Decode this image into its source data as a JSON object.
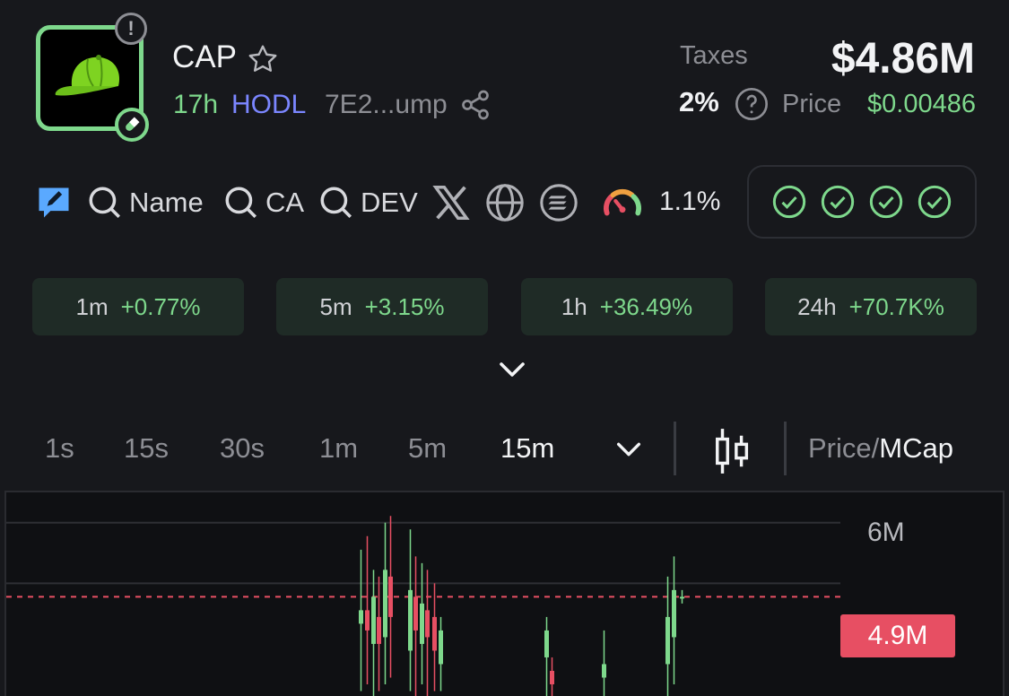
{
  "token": {
    "name": "CAP",
    "age": "17h",
    "tag": "HODL",
    "address": "7E2...ump",
    "warning_glyph": "!"
  },
  "stats": {
    "taxes_label": "Taxes",
    "taxes_value": "2%",
    "market_cap": "$4.86M",
    "price_label": "Price",
    "price_value": "$0.00486"
  },
  "tools": {
    "search_name": "Name",
    "search_ca": "CA",
    "search_dev": "DEV",
    "gauge_value": "1.1%",
    "icons": [
      "edit-icon",
      "search-icon",
      "x-icon",
      "globe-icon",
      "solana-icon",
      "gauge-icon"
    ],
    "checks_count": 4
  },
  "changes": [
    {
      "label": "1m",
      "value": "+0.77%"
    },
    {
      "label": "5m",
      "value": "+3.15%"
    },
    {
      "label": "1h",
      "value": "+36.49%"
    },
    {
      "label": "24h",
      "value": "+70.7K%"
    }
  ],
  "timeframes": {
    "items": [
      "1s",
      "15s",
      "30s",
      "1m",
      "5m",
      "15m"
    ],
    "active": "15m",
    "toggle_price": "Price",
    "toggle_sep": "/",
    "toggle_mcap": "MCap"
  },
  "chart_data": {
    "type": "candlestick",
    "y_ticks": [
      "6M"
    ],
    "current_value_label": "4.9M",
    "current_value": 4.9,
    "ylim": [
      3.4,
      6.45
    ],
    "colors": {
      "up": "#7ed88c",
      "down": "#e74f63",
      "grid": "#2e2f34",
      "current": "#e74f63"
    },
    "candles": [
      {
        "i": 0,
        "o": 4.5,
        "c": 4.7,
        "h": 5.6,
        "l": 3.5
      },
      {
        "i": 1,
        "o": 4.7,
        "c": 4.4,
        "h": 5.8,
        "l": 3.6
      },
      {
        "i": 2,
        "o": 4.2,
        "c": 4.9,
        "h": 5.3,
        "l": 3.4
      },
      {
        "i": 3,
        "o": 4.6,
        "c": 4.2,
        "h": 5.2,
        "l": 3.5
      },
      {
        "i": 4,
        "o": 4.3,
        "c": 5.3,
        "h": 6.0,
        "l": 3.6
      },
      {
        "i": 5,
        "o": 5.2,
        "c": 4.6,
        "h": 6.1,
        "l": 3.7
      },
      {
        "i": 6,
        "o": 4.1,
        "c": 5.0,
        "h": 5.9,
        "l": 3.5
      },
      {
        "i": 7,
        "o": 4.9,
        "c": 4.4,
        "h": 5.5,
        "l": 3.4
      },
      {
        "i": 8,
        "o": 4.2,
        "c": 4.8,
        "h": 5.4,
        "l": 3.6
      },
      {
        "i": 9,
        "o": 4.7,
        "c": 4.3,
        "h": 5.3,
        "l": 3.4
      },
      {
        "i": 10,
        "o": 4.6,
        "c": 4.1,
        "h": 5.1,
        "l": 3.5
      },
      {
        "i": 11,
        "o": 3.9,
        "c": 4.4,
        "h": 4.6,
        "l": 3.5
      },
      {
        "i": 12,
        "o": 4.0,
        "c": 4.4,
        "h": 4.6,
        "l": 3.4
      },
      {
        "i": 13,
        "o": 3.8,
        "c": 3.6,
        "h": 4.0,
        "l": 3.4
      },
      {
        "i": 14,
        "o": 3.7,
        "c": 3.9,
        "h": 4.4,
        "l": 3.4
      },
      {
        "i": 15,
        "o": 3.9,
        "c": 4.6,
        "h": 5.2,
        "l": 3.4
      },
      {
        "i": 16,
        "o": 4.3,
        "c": 5.0,
        "h": 5.5,
        "l": 3.6
      },
      {
        "i": 17,
        "o": 4.9,
        "c": 4.9,
        "h": 5.0,
        "l": 4.8
      }
    ]
  }
}
